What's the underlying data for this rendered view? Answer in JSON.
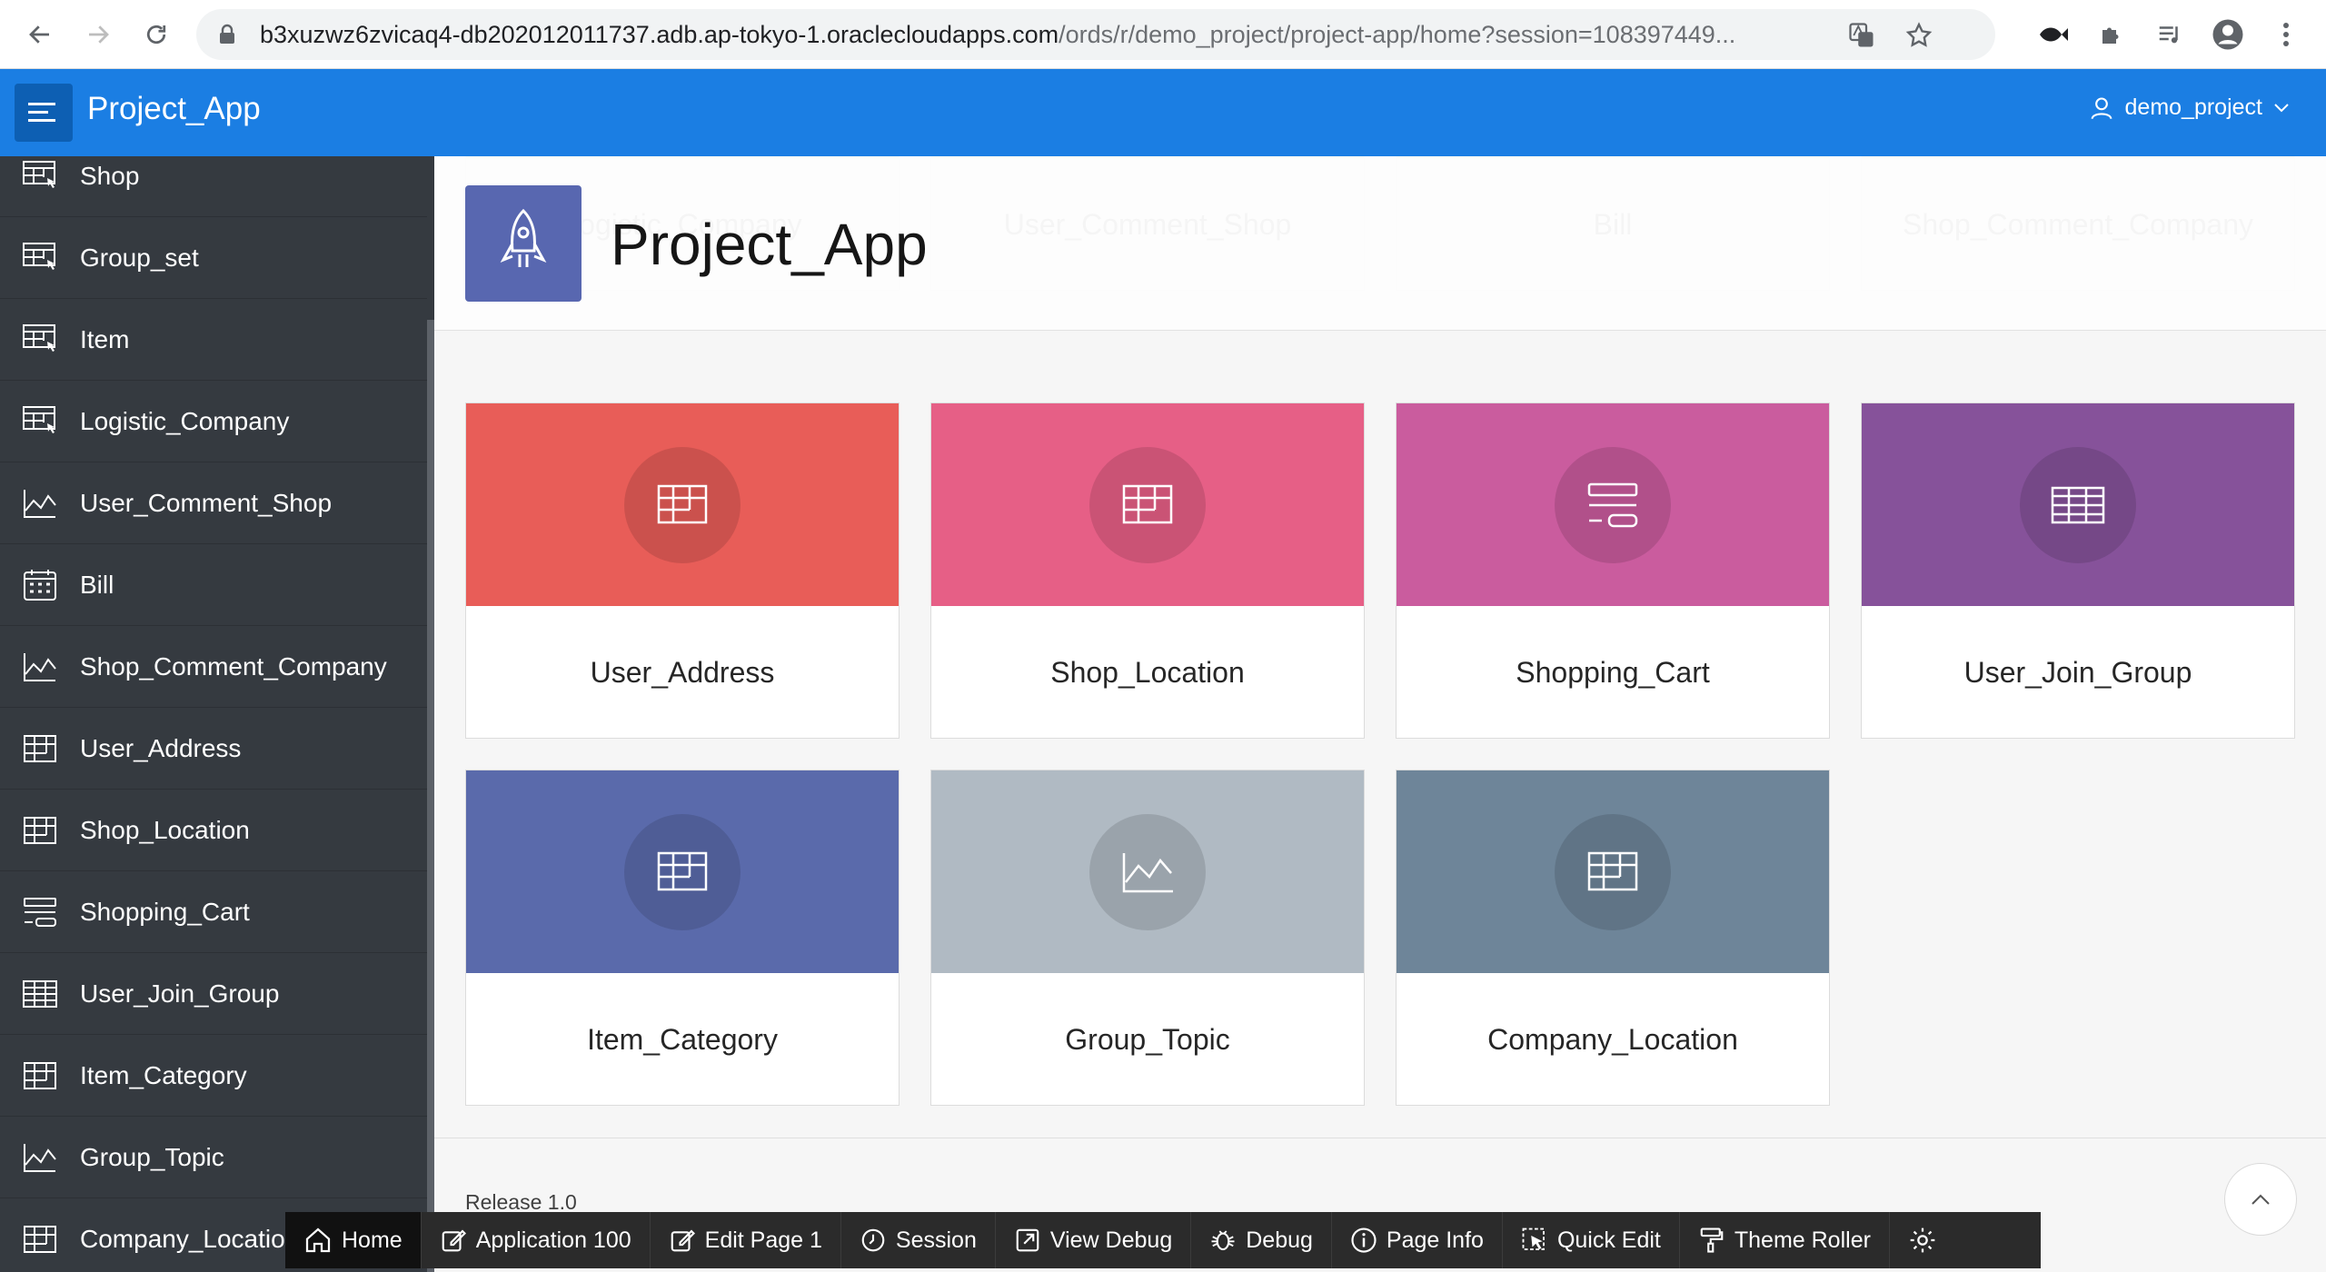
{
  "browser": {
    "url_host": "b3xuzwz6zvicaq4-db202012011737.adb.ap-tokyo-1.oraclecloudapps.com",
    "url_path": "/ords/r/demo_project/project-app/home?session=108397449..."
  },
  "header": {
    "app_title": "Project_App",
    "user": "demo_project"
  },
  "sidebar": {
    "items": [
      {
        "label": "Shop",
        "icon": "table-pointer-icon"
      },
      {
        "label": "Group_set",
        "icon": "table-pointer-icon"
      },
      {
        "label": "Item",
        "icon": "table-pointer-icon"
      },
      {
        "label": "Logistic_Company",
        "icon": "table-pointer-icon"
      },
      {
        "label": "User_Comment_Shop",
        "icon": "chart-line-icon"
      },
      {
        "label": "Bill",
        "icon": "calendar-icon"
      },
      {
        "label": "Shop_Comment_Company",
        "icon": "chart-line-icon"
      },
      {
        "label": "User_Address",
        "icon": "grid-icon"
      },
      {
        "label": "Shop_Location",
        "icon": "grid-icon"
      },
      {
        "label": "Shopping_Cart",
        "icon": "form-icon"
      },
      {
        "label": "User_Join_Group",
        "icon": "table-icon"
      },
      {
        "label": "Item_Category",
        "icon": "grid-icon"
      },
      {
        "label": "Group_Topic",
        "icon": "chart-line-icon"
      },
      {
        "label": "Company_Location",
        "icon": "grid-icon"
      }
    ]
  },
  "hero": {
    "title": "Project_App",
    "icon": "rocket-icon"
  },
  "faded_cards": [
    {
      "label": "Logistic_Company",
      "color": "#7cc47f"
    },
    {
      "label": "User_Comment_Shop",
      "color": "#e6e25a"
    },
    {
      "label": "Bill",
      "color": "#f5d26b"
    },
    {
      "label": "Shop_Comment_Company",
      "color": "#f29d6b"
    }
  ],
  "cards": [
    {
      "label": "User_Address",
      "color": "#e85d58",
      "icon": "grid-icon"
    },
    {
      "label": "Shop_Location",
      "color": "#e65f86",
      "icon": "grid-icon"
    },
    {
      "label": "Shopping_Cart",
      "color": "#ca5c9e",
      "icon": "form-icon"
    },
    {
      "label": "User_Join_Group",
      "color": "#86529a",
      "icon": "table-icon"
    },
    {
      "label": "Item_Category",
      "color": "#5a6aab",
      "icon": "grid-icon"
    },
    {
      "label": "Group_Topic",
      "color": "#b0bac3",
      "icon": "chart-line-icon"
    },
    {
      "label": "Company_Location",
      "color": "#6e8599",
      "icon": "grid-icon"
    }
  ],
  "footer": {
    "release": "Release 1.0"
  },
  "devbar": {
    "home": "Home",
    "application": "Application 100",
    "edit_page": "Edit Page 1",
    "session": "Session",
    "view_debug": "View Debug",
    "debug": "Debug",
    "page_info": "Page Info",
    "quick_edit": "Quick Edit",
    "theme_roller": "Theme Roller"
  }
}
